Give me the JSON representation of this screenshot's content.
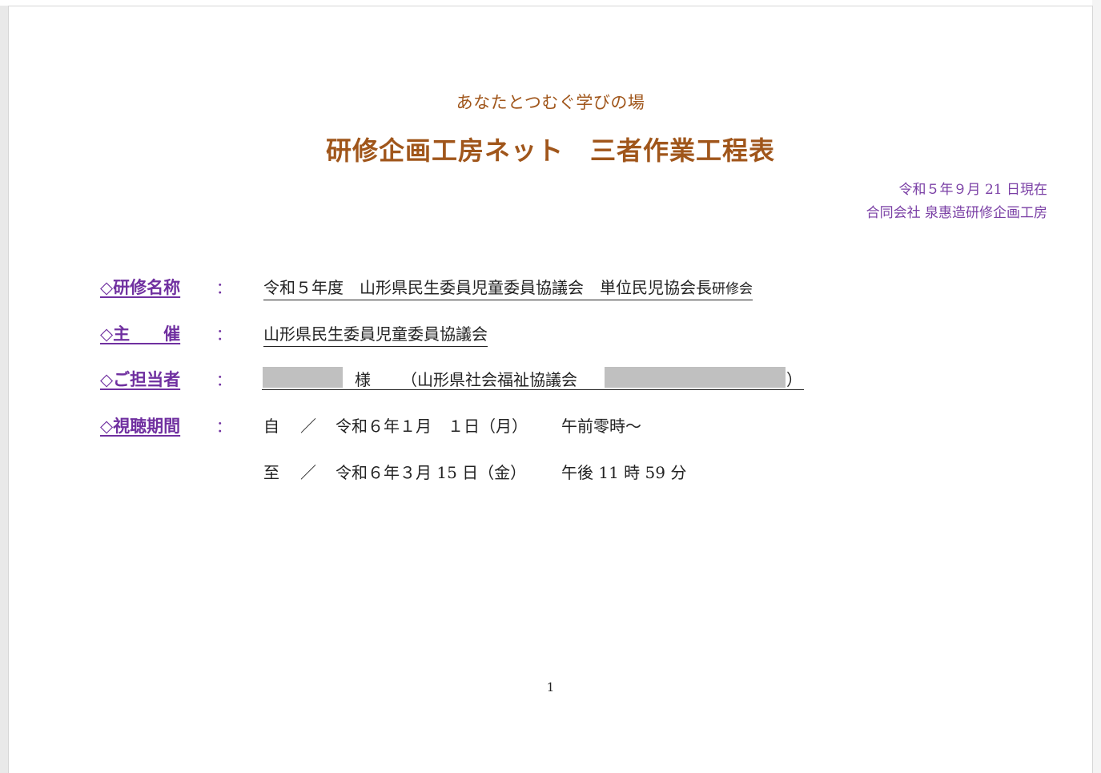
{
  "header": {
    "subtitle": "あなたとつむぐ学びの場",
    "title": "研修企画工房ネット　三者作業工程表",
    "date": "令和５年９月 21 日現在",
    "company": "合同会社 泉惠造研修企画工房"
  },
  "fields": {
    "training_name": {
      "label": "◇研修名称",
      "colon": "：",
      "value_main": "令和５年度　山形県民生委員児童委員協議会　単位民児協会長",
      "value_small": "研修会"
    },
    "organizer": {
      "label": "◇主　　催",
      "colon": "：",
      "value": "山形県民生委員児童委員協議会"
    },
    "contact": {
      "label": "◇ご担当者",
      "colon": "：",
      "sama": "様",
      "org_open": "（山形県社会福祉協議会",
      "close": "）"
    },
    "period": {
      "label": "◇視聴期間",
      "colon": "：",
      "from_kanji": "自",
      "from_slash": "／",
      "from_date": "令和６年１月　１日（月）",
      "from_time": "午前零時～",
      "to_kanji": "至",
      "to_slash": "／",
      "to_date": "令和６年３月 15 日（金）",
      "to_time": "午後 11 時 59 分"
    }
  },
  "footer": {
    "page_number": "1"
  },
  "colors": {
    "title": "#a0561b",
    "label": "#7030a0",
    "meta": "#7a3fa5",
    "redaction": "#c0c0c0"
  }
}
